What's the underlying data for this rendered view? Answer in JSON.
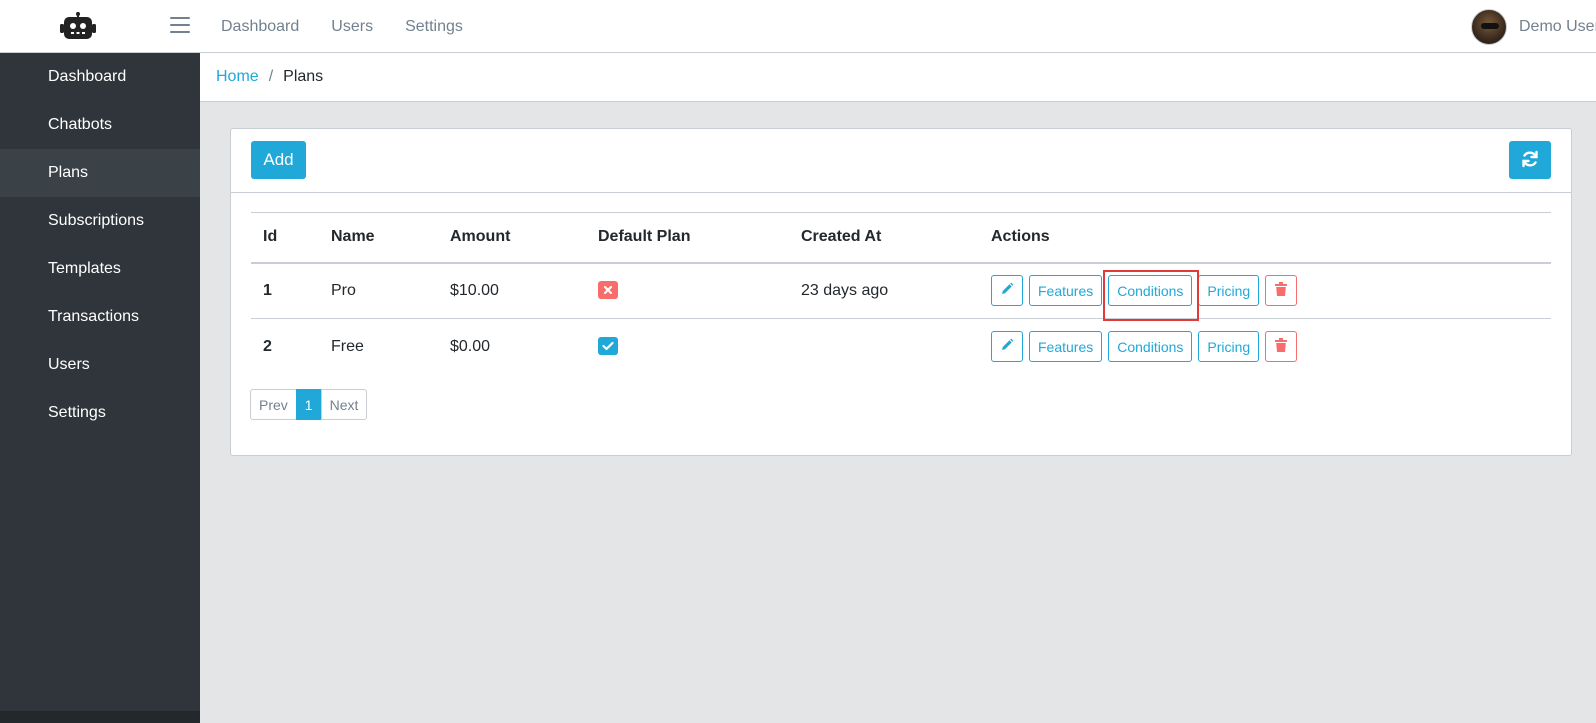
{
  "topnav": {
    "items": [
      "Dashboard",
      "Users",
      "Settings"
    ],
    "user_name": "Demo User"
  },
  "sidebar": {
    "items": [
      {
        "label": "Dashboard"
      },
      {
        "label": "Chatbots"
      },
      {
        "label": "Plans",
        "active": true
      },
      {
        "label": "Subscriptions"
      },
      {
        "label": "Templates"
      },
      {
        "label": "Transactions"
      },
      {
        "label": "Users"
      },
      {
        "label": "Settings"
      }
    ]
  },
  "breadcrumb": {
    "home": "Home",
    "separator": "/",
    "current": "Plans"
  },
  "toolbar": {
    "add_label": "Add",
    "refresh_icon": "refresh-icon"
  },
  "table": {
    "columns": [
      "Id",
      "Name",
      "Amount",
      "Default Plan",
      "Created At",
      "Actions"
    ],
    "rows": [
      {
        "id": "1",
        "name": "Pro",
        "amount": "$10.00",
        "default": false,
        "created": "23 days ago"
      },
      {
        "id": "2",
        "name": "Free",
        "amount": "$0.00",
        "default": true,
        "created": ""
      }
    ],
    "actions": {
      "features": "Features",
      "conditions": "Conditions",
      "pricing": "Pricing"
    }
  },
  "pagination": {
    "prev": "Prev",
    "page": "1",
    "next": "Next"
  },
  "colors": {
    "primary": "#20a8d8",
    "danger": "#f86c6b",
    "sidebar": "#2f353a",
    "highlight": "#e03a3a"
  }
}
